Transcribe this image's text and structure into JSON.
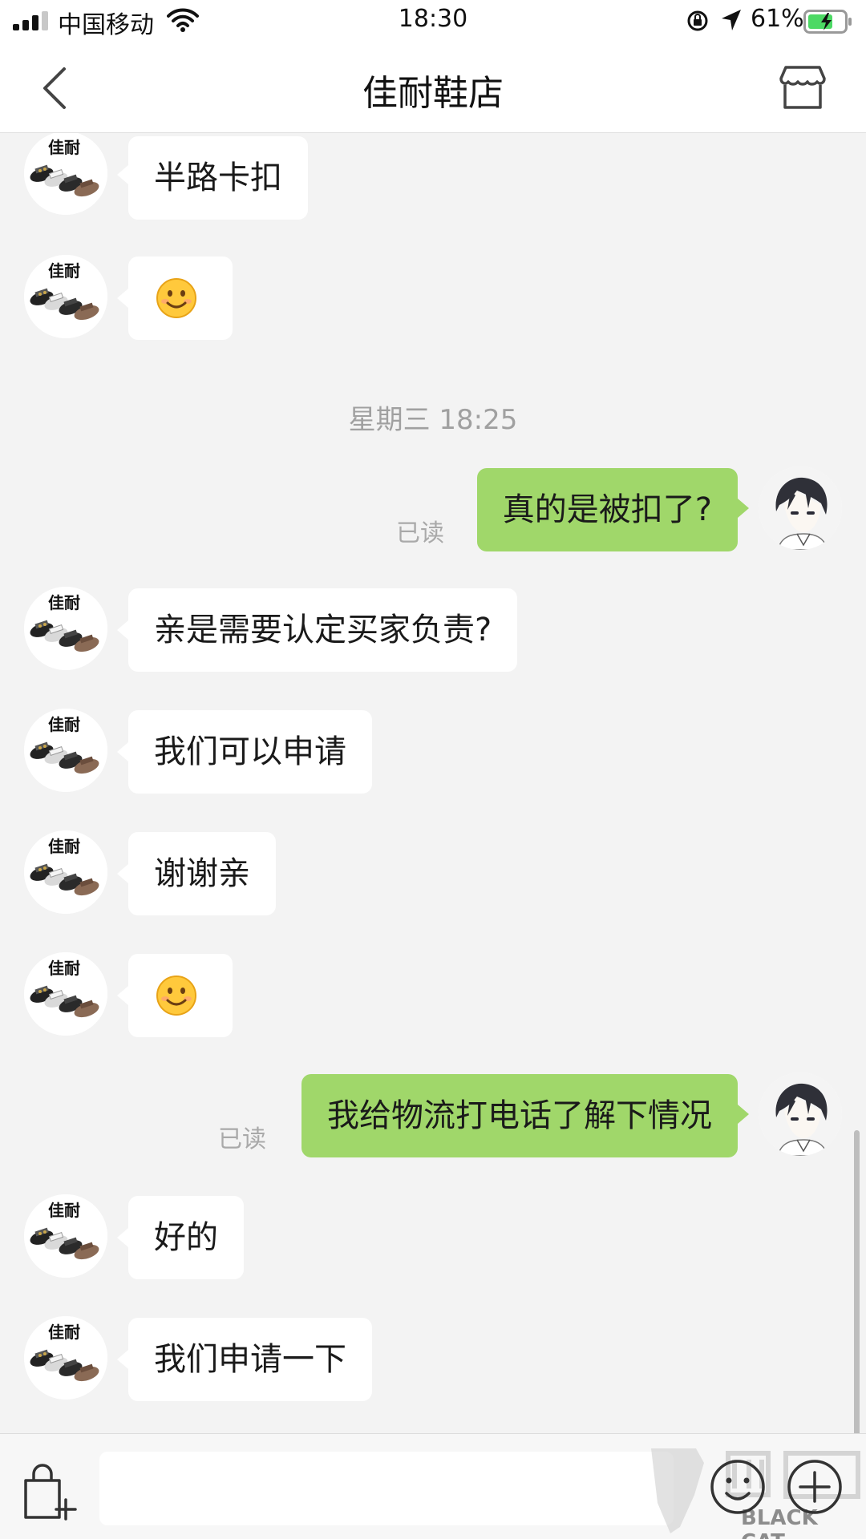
{
  "status_bar": {
    "carrier": "中国移动",
    "time": "18:30",
    "battery": "61%",
    "icons": [
      "signal-icon",
      "wifi-icon",
      "orientation-lock-icon",
      "location-icon",
      "battery-icon"
    ]
  },
  "header": {
    "title": "佳耐鞋店",
    "back_icon": "chevron-left-icon",
    "shop_icon": "store-icon"
  },
  "chat": {
    "shop_avatar_label": "佳耐",
    "timestamp": "星期三 18:25",
    "messages": [
      {
        "from": "shop",
        "text": "半路卡扣"
      },
      {
        "from": "shop",
        "text": "😊",
        "emoji": "smile-emoji"
      },
      {
        "from": "me",
        "text": "真的是被扣了?",
        "status": "已读"
      },
      {
        "from": "shop",
        "text": "亲是需要认定买家负责?"
      },
      {
        "from": "shop",
        "text": "我们可以申请"
      },
      {
        "from": "shop",
        "text": "谢谢亲"
      },
      {
        "from": "shop",
        "text": "😊",
        "emoji": "smile-emoji"
      },
      {
        "from": "me",
        "text": "我给物流打电话了解下情况",
        "status": "已读"
      },
      {
        "from": "shop",
        "text": "好的"
      },
      {
        "from": "shop",
        "text": "我们申请一下"
      }
    ]
  },
  "input_bar": {
    "value": "",
    "placeholder": "",
    "icons": [
      "shopping-bag-add-icon",
      "emoji-icon",
      "plus-icon"
    ]
  },
  "watermark": {
    "text": "BLACK CAT"
  },
  "colors": {
    "background": "#f3f3f3",
    "incoming_bubble": "#ffffff",
    "outgoing_bubble": "#a0d76a",
    "read_status": "#a9a9a9"
  }
}
